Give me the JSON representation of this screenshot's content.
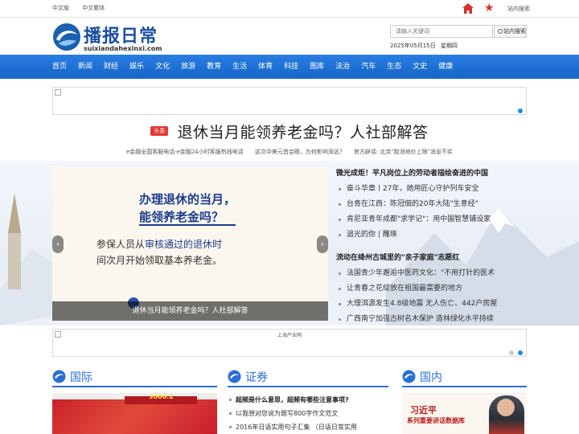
{
  "topbar": {
    "lang_simplified": "中文版",
    "lang_traditional": "中文繁体",
    "site_search_link": "站内搜索"
  },
  "header": {
    "logo_text": "播报日常",
    "logo_domain": "suixiandahexinxi.com",
    "search_placeholder": "请输入关键词",
    "search_button": "站内搜索",
    "date": "2025年05月15日",
    "weekday": "星期四"
  },
  "nav": {
    "items": [
      "首页",
      "新闻",
      "财经",
      "娱乐",
      "文化",
      "旅游",
      "教育",
      "生活",
      "体育",
      "科技",
      "图库",
      "法治",
      "汽车",
      "生态",
      "文史",
      "健康"
    ]
  },
  "headline": {
    "tag": "头条",
    "title": "退休当月能领养老金吗？人社部解答"
  },
  "subheads": [
    "e金融全国客服电话-e金融24小时客服热线电话",
    "这次中美元首会晤，为何影响深远?",
    "官方辟谣: 北京\"取消地价上限\"消息不实"
  ],
  "slider": {
    "image_line1": "办理退休的当月，",
    "image_line2": "能领养老金吗？",
    "image_line3_pre": "参保人员从",
    "image_line3_hl": "审核通过的退休时",
    "image_line4_pre": "间次月",
    "image_line4_post": "开始领取基本养老金。",
    "caption": "退休当月能领养老金吗？人社部解答",
    "prev": "‹",
    "next": "›"
  },
  "news_groups": [
    {
      "lead": "微光成炬！平凡岗位上的劳动者描绘奋进的中国",
      "items": [
        "奋斗华章丨27年，她用匠心守护列车安全",
        "台青在江西：陈冠佃的20年大陆\"生意经\"",
        "肯尼亚青年成都\"求学记\"：用中国智慧铺设家",
        "追光的你 | 雕琢"
      ]
    },
    {
      "lead": "流动在绛州古城里的\"亲子家庭\"志愿红",
      "items": [
        "法国青少年邂逅中医药文化：\"不用打针的医术",
        "让青春之花绽放在祖国最需要的地方",
        "大理洱源发生4.8级地震 无人伤亡、442户房屋",
        "广西南宁加强古树名木保护 造林绿化水平持续"
      ]
    }
  ],
  "banner2": {
    "text": "上海产业网"
  },
  "sections": {
    "intl": "国际",
    "securities": "证券",
    "domestic": "国内"
  },
  "securities_list": [
    "超频是什么意思，超频有哪些注意事项?",
    "以我想对您说为题写800字作文范文",
    "2016年日语实用句子汇集 （日语日常实用"
  ],
  "intl_photo": {
    "text": "3006.2"
  },
  "xi_photo": {
    "name": "习近平",
    "sub": "系列重要讲话数据库"
  },
  "colors": {
    "nav_blue": "#1a73e8",
    "accent_red": "#e53935",
    "section_blue": "#2a6fd6"
  }
}
